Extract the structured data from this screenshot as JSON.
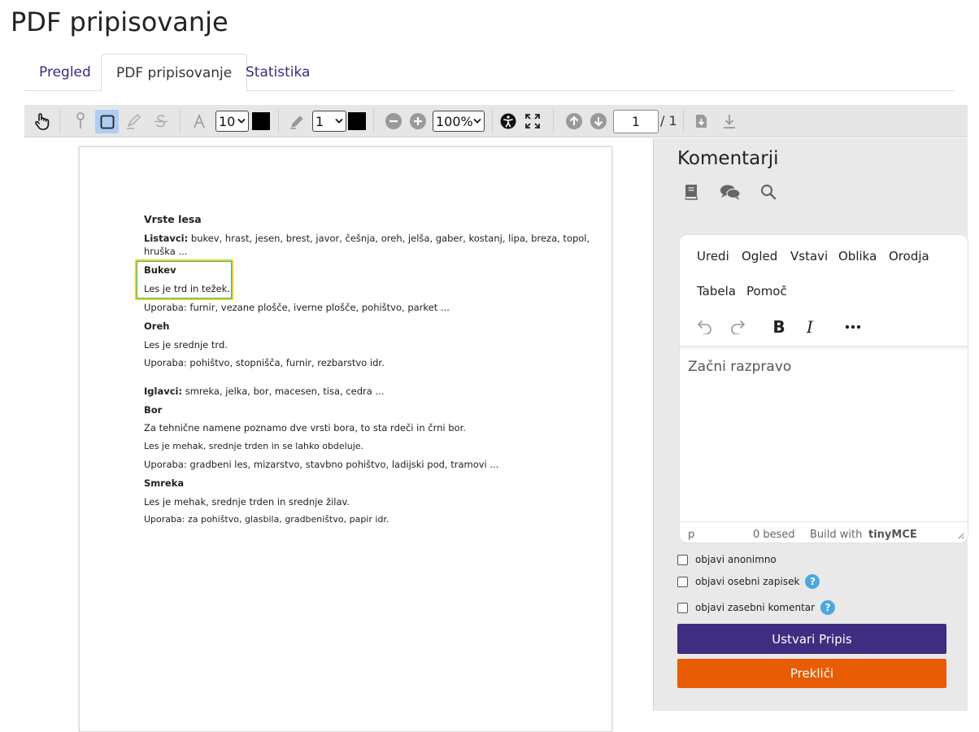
{
  "page": {
    "title": "PDF pripisovanje"
  },
  "tabs": [
    {
      "label": "Pregled"
    },
    {
      "label": "PDF pripisovanje"
    },
    {
      "label": "Statistika"
    }
  ],
  "toolbar": {
    "font_size": "10",
    "line_width": "1",
    "zoom": "100%",
    "page_current": "1",
    "page_total": "/ 1",
    "swatch_color": "#000000"
  },
  "document": {
    "title": "Vrste lesa",
    "listavci_label": "Listavci:",
    "listavci_text": " bukev, hrast, jesen, brest, javor, češnja, oreh, jelša, gaber, kostanj, lipa, breza, topol,",
    "listavci_text2": "hruška ...",
    "bukev_title": "Bukev",
    "bukev_line1": "Les je trd in težek.",
    "bukev_line2": "Uporaba: furnir, vezane plošče, iverne plošče, pohištvo, parket ...",
    "oreh_title": "Oreh",
    "oreh_line1": "Les je srednje trd.",
    "oreh_line2": "Uporaba: pohištvo, stopnišča, furnir, rezbarstvo idr.",
    "iglavci_label": "Iglavci:",
    "iglavci_text": " smreka, jelka, bor, macesen, tisa, cedra ...",
    "bor_title": "Bor",
    "bor_line1": "Za tehnične namene poznamo dve vrsti bora, to sta rdeči in črni bor.",
    "bor_line2": "Les je mehak, srednje trden in se lahko obdeluje.",
    "bor_line3": "Uporaba: gradbeni les, mizarstvo, stavbno pohištvo, ladijski pod, tramovi ...",
    "smreka_title": "Smreka",
    "smreka_line1": "Les je mehak, srednje trden in srednje žilav.",
    "smreka_line2": "Uporaba: za pohištvo, glasbila, gradbeništvo, papir idr."
  },
  "sidebar": {
    "title": "Komentarji",
    "editor": {
      "menu": [
        "Uredi",
        "Ogled",
        "Vstavi",
        "Oblika",
        "Orodja",
        "Tabela",
        "Pomoč"
      ],
      "bold_label": "B",
      "italic_label": "I",
      "placeholder": "Začni razpravo",
      "status_path": "p",
      "word_count": "0 besed",
      "branding": "Build with",
      "branding_brand": "tinyMCE"
    },
    "options": [
      {
        "label": "objavi anonimno",
        "help": false
      },
      {
        "label": "objavi osebni zapisek",
        "help": true
      },
      {
        "label": "objavi zasebni komentar",
        "help": true
      }
    ],
    "help_glyph": "?",
    "submit_label": "Ustvari Pripis",
    "cancel_label": "Prekliči"
  },
  "colors": {
    "accent": "#3e2d80",
    "cancel": "#e85d04",
    "help": "#4ba8e0",
    "tab_link": "#3c2b7b"
  }
}
